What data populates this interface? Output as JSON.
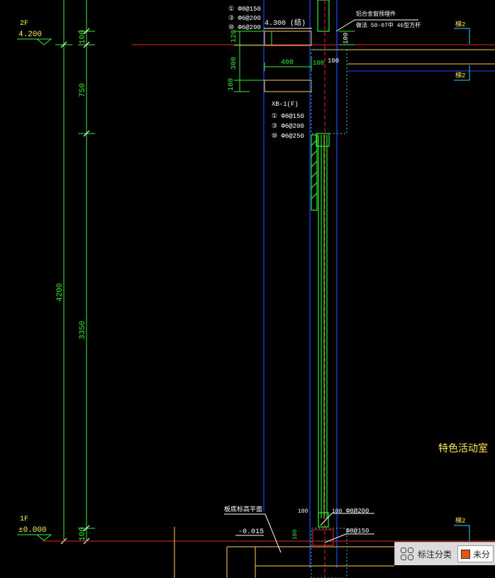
{
  "colors": {
    "background": "#000000",
    "dimension": "#33ee33",
    "level_text": "#ffee55",
    "red_line": "#ee2222",
    "blue_line": "#2244ff",
    "cyan_line": "#33cccc",
    "white_text": "#ffffff",
    "status_bg": "#dcdcdc",
    "chip_swatch": "#e8540c"
  },
  "levels": {
    "upper_name": "2F",
    "upper_value": "4.200",
    "lower_name": "1F",
    "lower_value": "±0.000"
  },
  "dimensions": {
    "overall": "4200",
    "top_100": "100",
    "upper_750": "750",
    "middle_3350": "3350",
    "bottom_100": "100",
    "beam_120": "120",
    "beam_300": "300",
    "beam_100": "100",
    "beam_width_400": "400",
    "wall_100": "100",
    "right_100": "100",
    "base_100a": "100",
    "base_100b": "100",
    "base_100c": "100"
  },
  "annotations": {
    "slab_elevation": "4.300 (结)",
    "rebar_top": [
      "① Φ8@150",
      "③ Φ6@200",
      "⑩ Φ6@200"
    ],
    "xb_title": "XB-1(F)",
    "rebar_xb": [
      "① Φ8@150",
      "③ Φ6@200",
      "⑩ Φ6@250"
    ],
    "note_line1": "铝合金窗预埋件",
    "note_line2": "做法 50-07中 46型方杆",
    "label_upper": "梯2",
    "label_mid": "梯2",
    "label_lower": "梯2",
    "room_name": "特色活动室",
    "plinth_label": "板底标高平面",
    "plinth_value": "-0.015",
    "base_rebar_1": "Φ8@200",
    "base_rebar_2": "Φ8@150"
  },
  "status_bar": {
    "category_label": "标注分类",
    "chip_label": "未分"
  }
}
